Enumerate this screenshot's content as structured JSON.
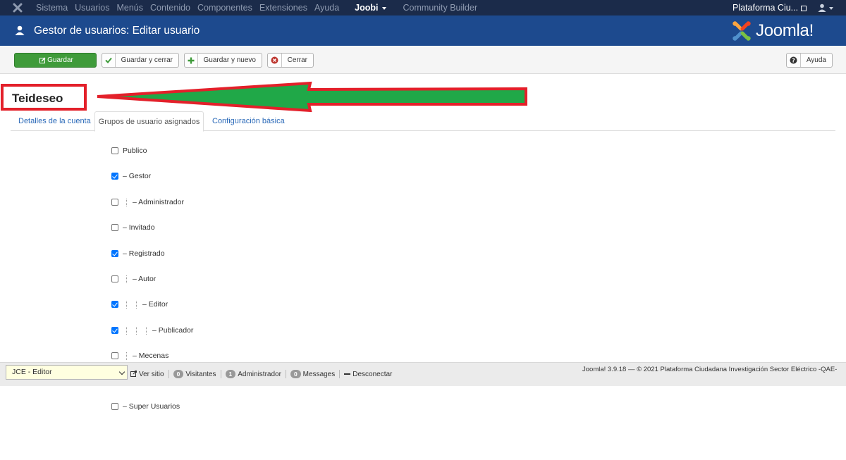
{
  "topnav": {
    "menu": [
      "Sistema",
      "Usuarios",
      "Menús",
      "Contenido",
      "Componentes",
      "Extensiones",
      "Ayuda"
    ],
    "active_menu": "Joobi",
    "extra_menu": "Community Builder",
    "site_label": "Plataforma Ciu..."
  },
  "header": {
    "title": "Gestor de usuarios: Editar usuario",
    "brand": "Joomla!"
  },
  "toolbar": {
    "save": "Guardar",
    "save_close": "Guardar y cerrar",
    "save_new": "Guardar y nuevo",
    "close": "Cerrar",
    "help": "Ayuda"
  },
  "user_name": "Teideseo",
  "tabs": [
    "Detalles de la cuenta",
    "Grupos de usuario asignados",
    "Configuración básica"
  ],
  "groups": [
    {
      "label": "Publico",
      "checked": false,
      "depth": 0
    },
    {
      "label": "– Gestor",
      "checked": true,
      "depth": 0
    },
    {
      "label": "– Administrador",
      "checked": false,
      "depth": 1
    },
    {
      "label": "– Invitado",
      "checked": false,
      "depth": 0
    },
    {
      "label": "– Registrado",
      "checked": true,
      "depth": 0
    },
    {
      "label": "– Autor",
      "checked": false,
      "depth": 1
    },
    {
      "label": "– Editor",
      "checked": true,
      "depth": 2
    },
    {
      "label": "– Publicador",
      "checked": true,
      "depth": 3
    },
    {
      "label": "– Mecenas",
      "checked": false,
      "depth": 1
    },
    {
      "label": "– Super Usuarios",
      "checked": false,
      "depth": 0
    }
  ],
  "statusbar": {
    "editor": "JCE - Editor",
    "view_site": "Ver sitio",
    "visitors_count": "0",
    "visitors": "Visitantes",
    "admins_count": "1",
    "admins": "Administrador",
    "messages_count": "0",
    "messages": "Messages",
    "logout": "Desconectar",
    "copyright": "Joomla! 3.9.18  —  © 2021 Plataforma Ciudadana Investigación Sector Eléctrico -QAE-"
  }
}
